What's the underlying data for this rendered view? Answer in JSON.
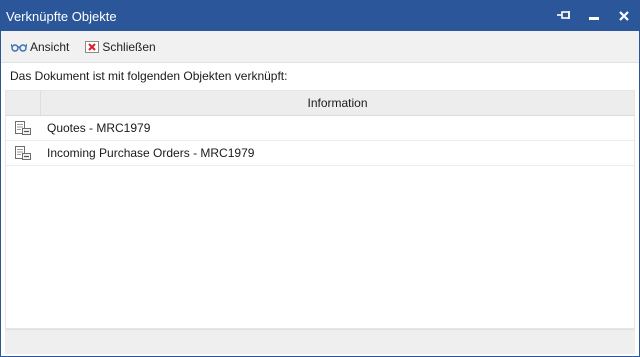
{
  "window": {
    "title": "Verknüpfte Objekte",
    "controls": [
      "pin-icon",
      "minimize-icon",
      "close-icon"
    ]
  },
  "toolbar": {
    "view_label": "Ansicht",
    "view_icon": "glasses-icon",
    "close_label": "Schließen",
    "close_icon": "close-x-icon"
  },
  "intro_text": "Das Dokument ist mit folgenden Objekten verknüpft:",
  "grid": {
    "header": "Information",
    "rows": [
      {
        "icon": "linked-document-icon",
        "text": "Quotes - MRC1979"
      },
      {
        "icon": "linked-document-icon",
        "text": "Incoming Purchase Orders - MRC1979"
      }
    ]
  },
  "colors": {
    "titlebar": "#2b579a",
    "toolbar_bg": "#f1f1f1",
    "close_icon_red": "#d9202a"
  }
}
